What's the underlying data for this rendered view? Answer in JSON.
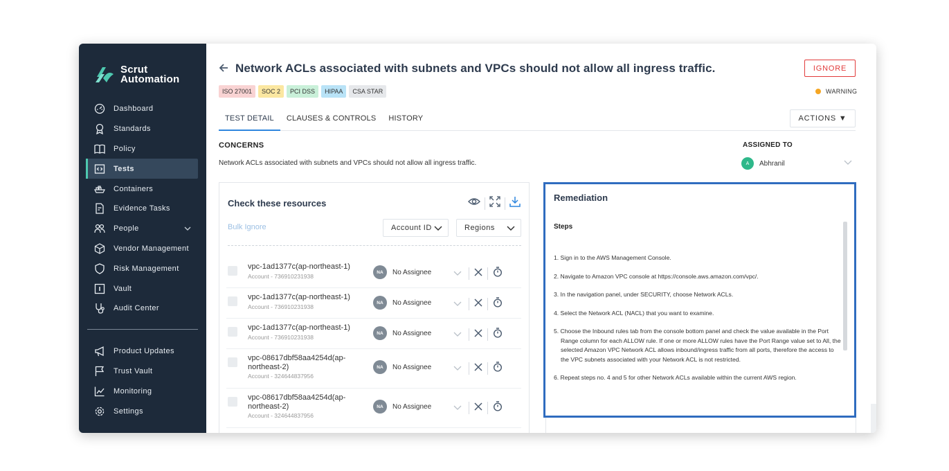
{
  "app": {
    "name_line1": "Scrut",
    "name_line2": "Automation"
  },
  "sidebar": {
    "items": [
      {
        "label": "Dashboard",
        "icon": "dashboard-icon"
      },
      {
        "label": "Standards",
        "icon": "award-icon"
      },
      {
        "label": "Policy",
        "icon": "book-icon"
      },
      {
        "label": "Tests",
        "icon": "code-icon",
        "active": true
      },
      {
        "label": "Containers",
        "icon": "container-icon"
      },
      {
        "label": "Evidence Tasks",
        "icon": "document-icon"
      },
      {
        "label": "People",
        "icon": "people-icon",
        "has_chevron": true
      },
      {
        "label": "Vendor Management",
        "icon": "cube-icon"
      },
      {
        "label": "Risk Management",
        "icon": "shield-icon"
      },
      {
        "label": "Vault",
        "icon": "vault-icon"
      },
      {
        "label": "Audit Center",
        "icon": "stethoscope-icon"
      }
    ],
    "bottom_items": [
      {
        "label": "Product Updates",
        "icon": "megaphone-icon"
      },
      {
        "label": "Trust Vault",
        "icon": "flag-icon"
      },
      {
        "label": "Monitoring",
        "icon": "chart-icon"
      },
      {
        "label": "Settings",
        "icon": "gear-icon"
      }
    ]
  },
  "header": {
    "title": "Network ACLs associated with subnets and VPCs should not allow all ingress traffic.",
    "ignore_label": "IGNORE",
    "severity": "WARNING",
    "severity_color": "#f5a623",
    "badges": [
      {
        "label": "ISO 27001",
        "color": "#f9d3d3"
      },
      {
        "label": "SOC 2",
        "color": "#fbe7a1"
      },
      {
        "label": "PCI DSS",
        "color": "#c9f0d9"
      },
      {
        "label": "HIPAA",
        "color": "#b9e3f7"
      },
      {
        "label": "CSA STAR",
        "color": "#e6e8eb"
      }
    ]
  },
  "tabs": [
    {
      "label": "TEST DETAIL",
      "active": true
    },
    {
      "label": "CLAUSES & CONTROLS"
    },
    {
      "label": "HISTORY"
    }
  ],
  "actions_label": "ACTIONS ▼",
  "concerns": {
    "heading": "CONCERNS",
    "text": "Network ACLs associated with subnets and VPCs should not allow all ingress traffic."
  },
  "assigned": {
    "heading": "ASSIGNED TO",
    "initial": "A",
    "name": "Abhranil"
  },
  "resources": {
    "title": "Check these resources",
    "bulk_ignore": "Bulk Ignore",
    "account_filter": "Account ID",
    "region_filter": "Regions",
    "rows": [
      {
        "name": "vpc-1ad1377c(ap-northeast-1)",
        "account": "Account - 736910231938",
        "assignee_initials": "NA",
        "assignee": "No Assignee"
      },
      {
        "name": "vpc-1ad1377c(ap-northeast-1)",
        "account": "Account - 736910231938",
        "assignee_initials": "NA",
        "assignee": "No Assignee"
      },
      {
        "name": "vpc-1ad1377c(ap-northeast-1)",
        "account": "Account - 736910231938",
        "assignee_initials": "NA",
        "assignee": "No Assignee"
      },
      {
        "name": "vpc-08617dbf58aa4254d(ap-northeast-2)",
        "account": "Account - 324644837956",
        "assignee_initials": "NA",
        "assignee": "No Assignee"
      },
      {
        "name": "vpc-08617dbf58aa4254d(ap-northeast-2)",
        "account": "Account - 324644837956",
        "assignee_initials": "NA",
        "assignee": "No Assignee"
      }
    ]
  },
  "remediation": {
    "title": "Remediation",
    "steps_heading": "Steps",
    "steps": [
      "1. Sign in to the AWS Management Console.",
      "2. Navigate to Amazon VPC console at https://console.aws.amazon.com/vpc/.",
      "3. In the navigation panel, under SECURITY, choose Network ACLs.",
      "4. Select the Network ACL (NACL) that you want to examine.",
      "5. Choose the Inbound rules tab from the console bottom panel and check the value available in the Port Range column for each ALLOW rule. If one or more ALLOW rules have the Port Range value set to All, the selected Amazon VPC Network ACL allows inbound/ingress traffic from all ports, therefore the access to the VPC subnets associated with your Network ACL is not restricted.",
      "6. Repeat steps no. 4 and 5 for other Network ACLs available within the current AWS region."
    ]
  }
}
